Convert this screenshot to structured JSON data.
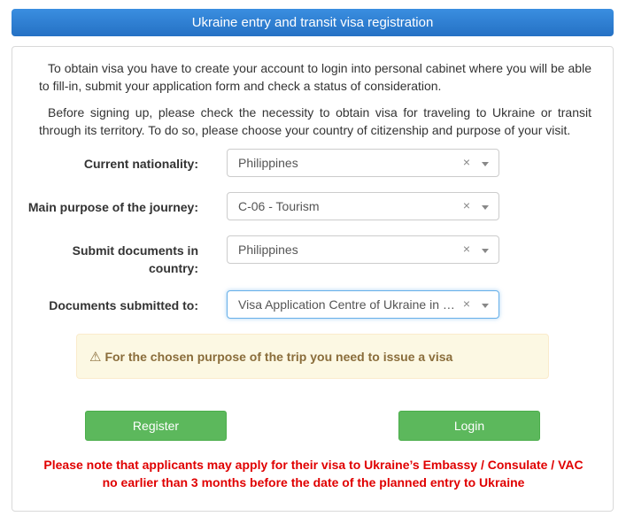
{
  "header": {
    "title": "Ukraine entry and transit visa registration"
  },
  "intro": {
    "paragraph1": "To obtain visa you have to create your account to login into personal cabinet where you will be able to fill-in, submit your application form and check a status of consideration.",
    "paragraph2": "Before signing up, please check the necessity to obtain visa for traveling to Ukraine or transit through its territory. To do so, please choose your country of citizenship and purpose of your visit."
  },
  "form": {
    "nationality": {
      "label": "Current nationality:",
      "value": "Philippines",
      "clear": "×"
    },
    "purpose": {
      "label": "Main purpose of the journey:",
      "value": "C-06 - Tourism",
      "clear": "×"
    },
    "submit_country": {
      "label": "Submit documents in country:",
      "value": "Philippines",
      "clear": "×"
    },
    "submitted_to": {
      "label": "Documents submitted to:",
      "value": "Visa Application Centre of Ukraine in Manila",
      "clear": "×"
    }
  },
  "alert": {
    "icon": "warning-triangle-icon",
    "symbol": "⚠",
    "text": "For the chosen purpose of the trip you need to issue a visa"
  },
  "buttons": {
    "register": "Register",
    "login": "Login"
  },
  "note": {
    "line1": "Please note that applicants may apply for their visa to Ukraine’s Embassy / Consulate / VAC",
    "line2": "no earlier than 3 months before the date of the planned entry to Ukraine"
  },
  "colors": {
    "header": "#2f7fd1",
    "button": "#5cb85c",
    "alert_bg": "#fcf8e3",
    "note": "#e00000"
  }
}
